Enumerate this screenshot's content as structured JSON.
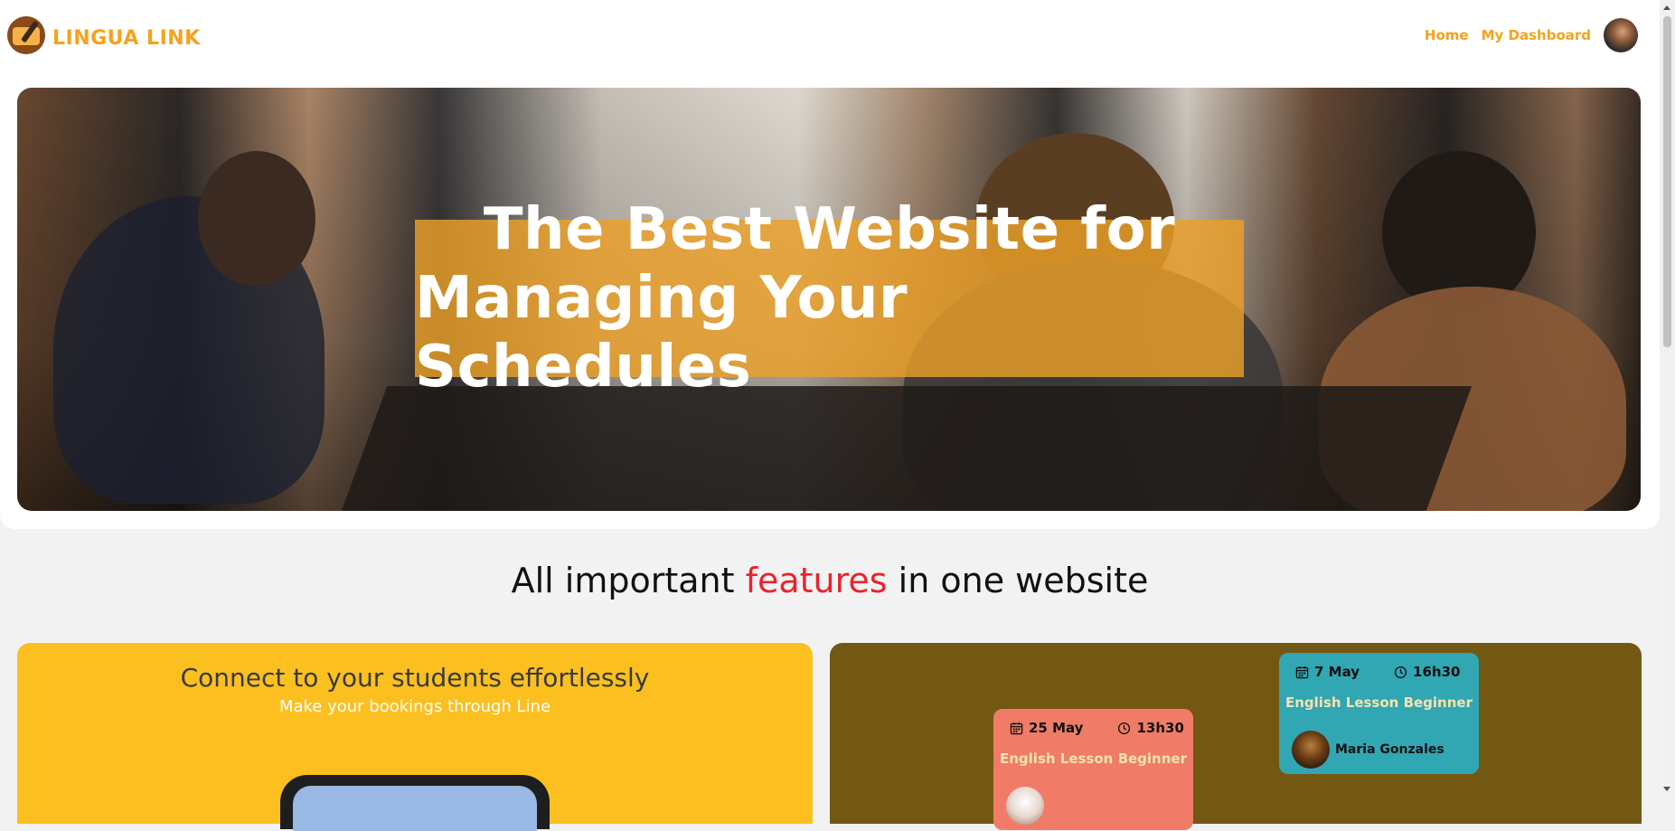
{
  "brand": {
    "name": "LINGUA LINK",
    "logo_icon": "book-pen-logo-icon"
  },
  "nav": {
    "links": [
      {
        "label": "Home"
      },
      {
        "label": "My Dashboard"
      }
    ],
    "avatar_icon": "user-avatar"
  },
  "hero": {
    "line1": "The Best Website for",
    "line2": "Managing Your Schedules"
  },
  "features": {
    "prefix": "All important ",
    "highlight": "features",
    "suffix": " in one website"
  },
  "card_connect": {
    "title": "Connect to your students effortlessly",
    "subtitle": "Make your bookings through Line"
  },
  "lessons": [
    {
      "date": "7 May",
      "time": "16h30",
      "title": "English Lesson Beginner",
      "teacher": "Maria Gonzales"
    },
    {
      "date": "25 May",
      "time": "13h30",
      "title": "English Lesson Beginner",
      "teacher": ""
    }
  ],
  "colors": {
    "brand_orange": "#f7a21b",
    "hero_overlay": "#eca028",
    "highlight_red": "#e8242e",
    "card_yellow": "#fbc020",
    "card_brown": "#735813",
    "lesson_teal": "#30a7b3",
    "lesson_salmon": "#f07c68"
  }
}
